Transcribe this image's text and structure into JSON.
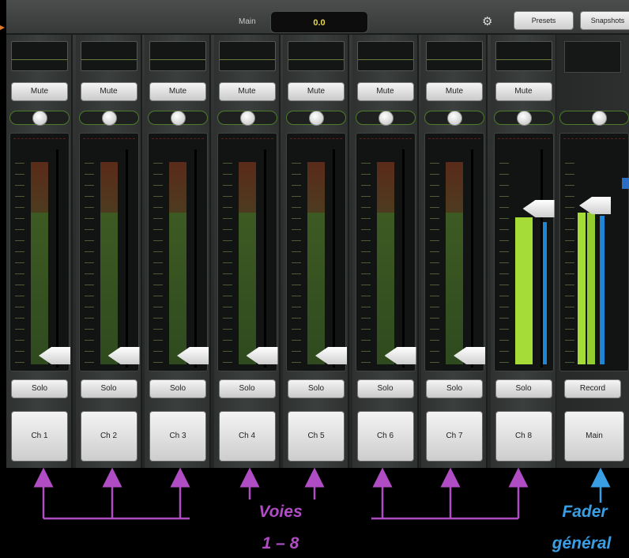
{
  "header": {
    "main_label": "Main",
    "main_value": "0.0",
    "presets_label": "Presets",
    "snapshots_label": "Snapshots",
    "gear_icon": "gear-icon"
  },
  "channels": [
    {
      "mute": "Mute",
      "solo": "Solo",
      "name": "Ch 1"
    },
    {
      "mute": "Mute",
      "solo": "Solo",
      "name": "Ch 2"
    },
    {
      "mute": "Mute",
      "solo": "Solo",
      "name": "Ch 3"
    },
    {
      "mute": "Mute",
      "solo": "Solo",
      "name": "Ch 4"
    },
    {
      "mute": "Mute",
      "solo": "Solo",
      "name": "Ch 5"
    },
    {
      "mute": "Mute",
      "solo": "Solo",
      "name": "Ch 6"
    },
    {
      "mute": "Mute",
      "solo": "Solo",
      "name": "Ch 7"
    },
    {
      "mute": "Mute",
      "solo": "Solo",
      "name": "Ch 8"
    }
  ],
  "master": {
    "record": "Record",
    "name": "Main"
  },
  "annotations": {
    "channels_line1": "Voies",
    "channels_line2": "1 – 8",
    "master_line1": "Fader",
    "master_line2": "général"
  },
  "colors": {
    "channels_annotation": "#b04cc4",
    "master_annotation": "#3a9ee4",
    "meter_green": "#a6dc38",
    "meter_blue": "#1e86d4",
    "readout_text": "#e8d84a"
  }
}
